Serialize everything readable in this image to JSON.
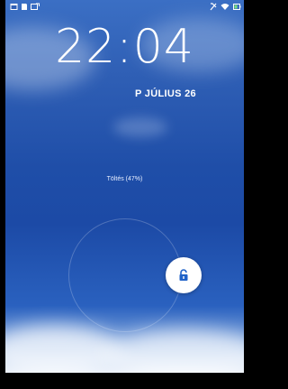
{
  "lockscreen": {
    "time": "22:04",
    "date": "P JÚLIUS 26",
    "charging_text": "Töltés (47%)",
    "battery_percent": 47
  },
  "status_bar": {
    "left_icons": [
      "gallery-icon",
      "sd-card-icon",
      "screenshot-icon"
    ],
    "right_icons": [
      "no-sim-icon",
      "wifi-icon",
      "battery-icon"
    ]
  },
  "unlock": {
    "icon": "unlock-padlock-icon",
    "accent": "#1f62c8"
  },
  "colors": {
    "sky_top": "#3b6fc4",
    "sky_mid": "#1c4aa6",
    "horizon": "#e6eefa"
  }
}
